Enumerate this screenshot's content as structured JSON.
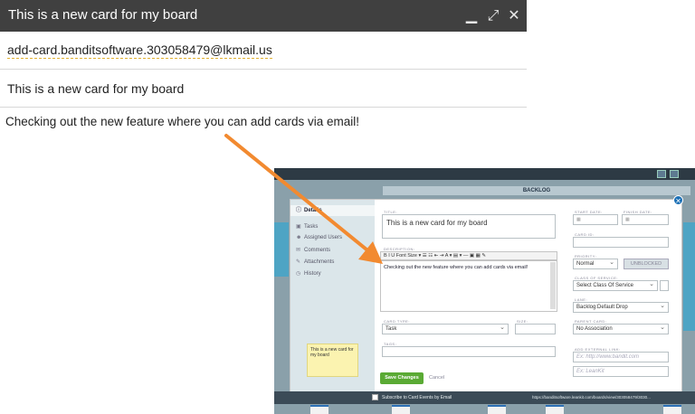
{
  "compose": {
    "title": "This is a new card for my board",
    "to": "add-card.banditsoftware.303058479@lkmail.us",
    "subject": "This is a new card for my board",
    "body": "Checking out the new feature where you can add cards via email!"
  },
  "screenshot": {
    "board_header": "BACKLOG",
    "sidebar": {
      "items": [
        "Details",
        "Tasks",
        "Assigned Users",
        "Comments",
        "Attachments",
        "History"
      ]
    },
    "sticky_note": "This is a new card for my board",
    "labels": {
      "title": "TITLE:",
      "description": "DESCRIPTION:",
      "start_date": "START DATE:",
      "finish_date": "FINISH DATE:",
      "card_id": "CARD ID:",
      "priority": "PRIORITY:",
      "class_of_service": "CLASS OF SERVICE:",
      "lane": "LANE:",
      "parent_card": "PARENT CARD:",
      "card_type": "CARD TYPE:",
      "size": "SIZE:",
      "tags": "TAGS:",
      "add_external_link": "ADD EXTERNAL LINK:"
    },
    "title_value": "This is a new card for my board",
    "toolbar_text": "B  I  U  Font Size ▾  ☰  ☷  ⇤  ⇥  A ▾  ▤ ▾  —  ▣  ▦  ✎",
    "description_value": "Checking out the new feature where you can add cards via email!",
    "priority_value": "Normal",
    "unblocked_label": "UNBLOCKED",
    "class_of_service_value": "Select Class Of Service",
    "lane_value": "Backlog:Default Drop",
    "parent_card_value": "No Association",
    "card_type_value": "Task",
    "external_link_placeholder": "Ex: http://www.bandit.com",
    "external_link_label_placeholder": "Ex: LeanKit",
    "save_label": "Save Changes",
    "cancel_label": "Cancel",
    "subscribe_label": "Subscribe to Card Events by Email",
    "card_url": "https://banditsoftware.leankit.com/boards/view/303058479/3030..."
  },
  "colors": {
    "header_bg": "#404040",
    "arrow": "#f28a30",
    "save_green": "#5aaa34",
    "accent_blue": "#1a6fb5"
  }
}
